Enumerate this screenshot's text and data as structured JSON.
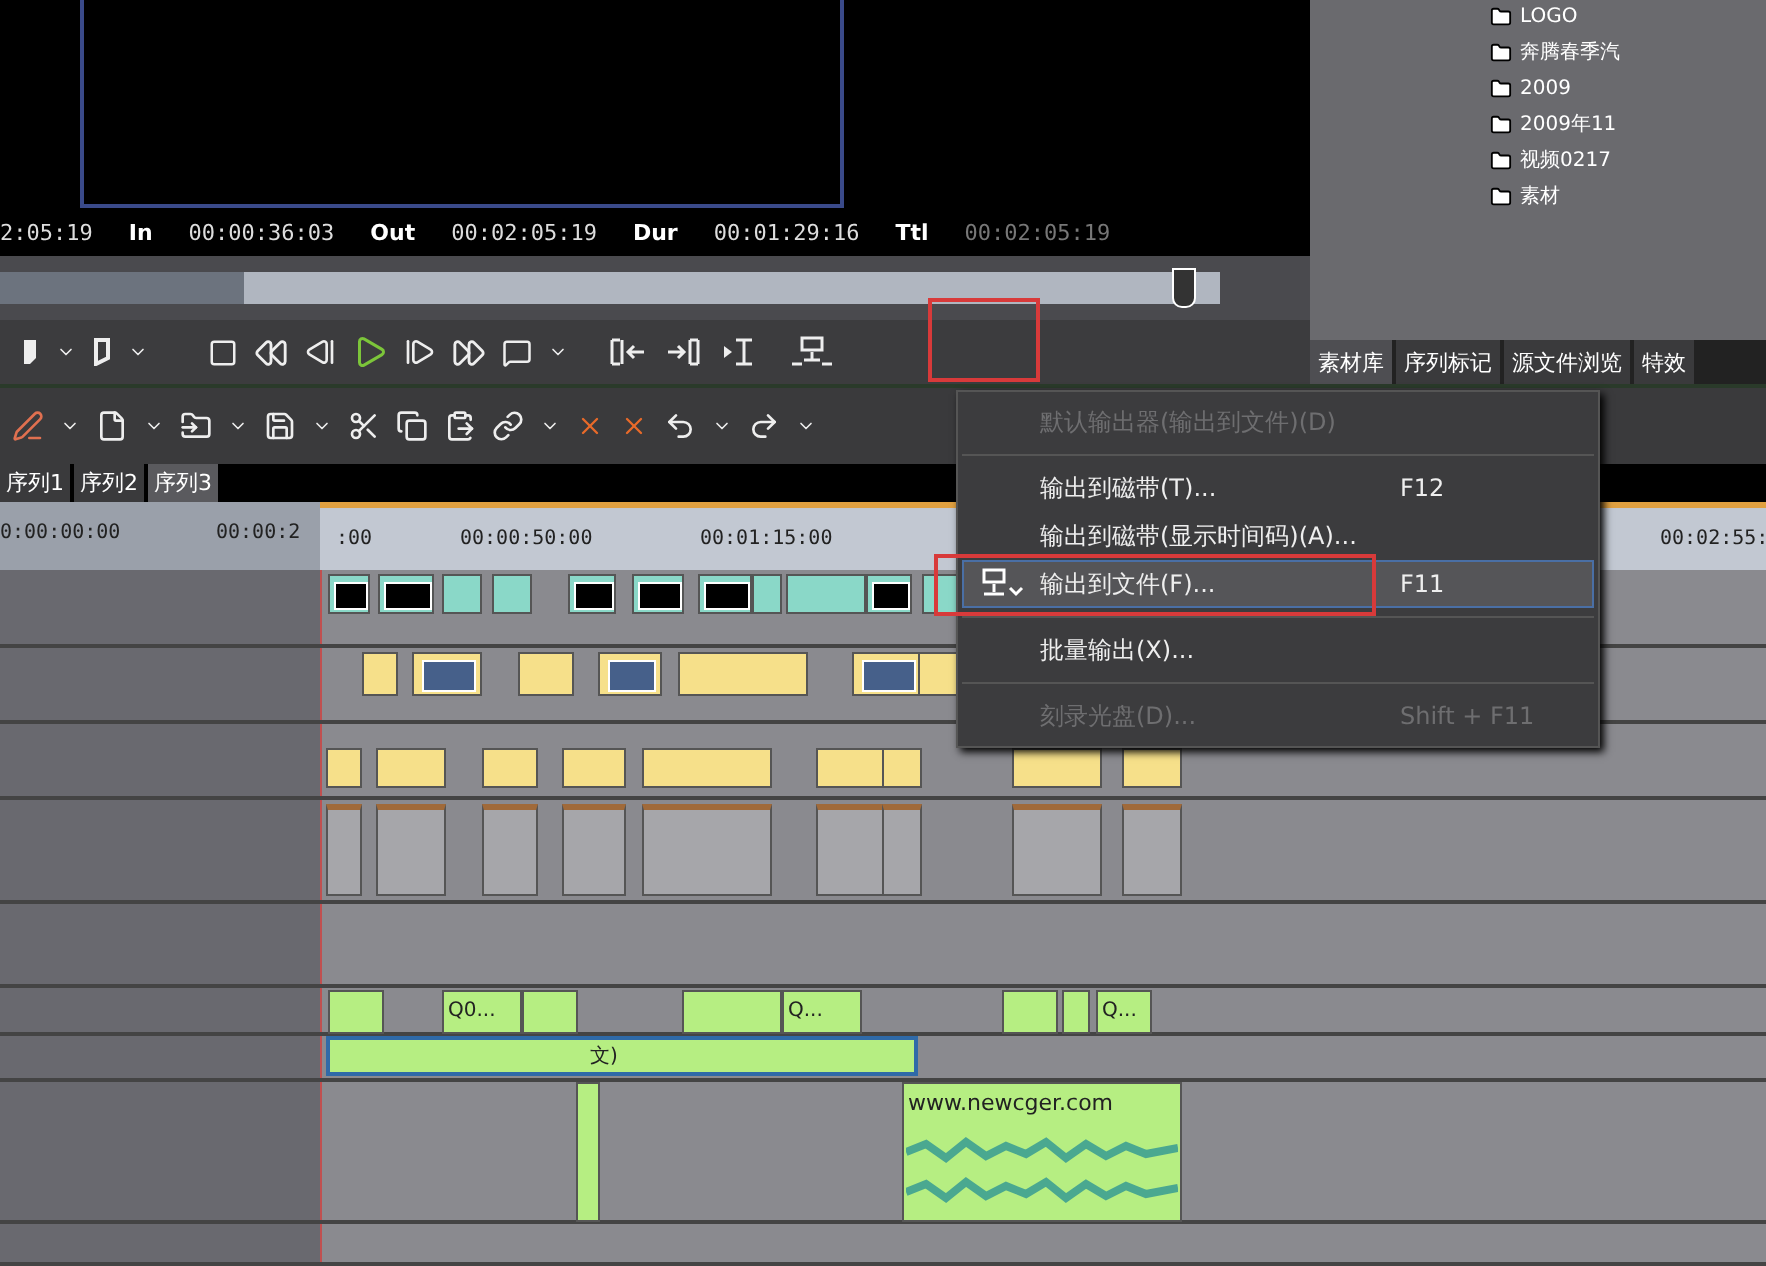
{
  "preview": {
    "timecodes": [
      {
        "value": "2:05:19",
        "dim": false
      },
      {
        "label": "In",
        "value": "00:00:36:03",
        "dim": false
      },
      {
        "label": "Out",
        "value": "00:02:05:19",
        "dim": false
      },
      {
        "label": "Dur",
        "value": "00:01:29:16",
        "dim": false
      },
      {
        "label": "Ttl",
        "value": "00:02:05:19",
        "dim": true
      }
    ],
    "scrub": {
      "level": 0.98
    }
  },
  "bin": {
    "items": [
      {
        "label": "LOGO"
      },
      {
        "label": "奔腾春季汽"
      },
      {
        "label": "2009"
      },
      {
        "label": "2009年11"
      },
      {
        "label": "视频0217"
      },
      {
        "label": "素材"
      }
    ],
    "tabs": [
      {
        "label": "素材库",
        "selected": true
      },
      {
        "label": "序列标记",
        "selected": false
      },
      {
        "label": "源文件浏览",
        "selected": false
      },
      {
        "label": "特效",
        "selected": false
      }
    ]
  },
  "sequence_tabs": [
    {
      "label": "序列1",
      "selected": false
    },
    {
      "label": "序列2",
      "selected": false
    },
    {
      "label": "序列3",
      "selected": true
    }
  ],
  "ruler": {
    "labels": [
      "0:00:00:00",
      "00:00:2",
      ":00",
      "00:00:50:00",
      "00:01:15:00",
      "00:02:55:"
    ]
  },
  "title_clips": [
    "Q0...",
    "Q...",
    "Q...",
    "文)"
  ],
  "audio_clip": {
    "label": "www.newcger.com"
  },
  "menu": {
    "items": [
      {
        "kind": "item",
        "label": "默认输出器(输出到文件)(D)",
        "disabled": true,
        "selected": false,
        "icon": false
      },
      {
        "kind": "separator"
      },
      {
        "kind": "item",
        "label": "输出到磁带(T)...",
        "shortcut": "F12",
        "disabled": false,
        "selected": false,
        "icon": false
      },
      {
        "kind": "item",
        "label": "输出到磁带(显示时间码)(A)...",
        "disabled": false,
        "selected": false,
        "icon": false
      },
      {
        "kind": "item",
        "label": "输出到文件(F)...",
        "shortcut": "F11",
        "disabled": false,
        "selected": true,
        "icon": true
      },
      {
        "kind": "separator"
      },
      {
        "kind": "item",
        "label": "批量输出(X)...",
        "disabled": false,
        "selected": false,
        "icon": false
      },
      {
        "kind": "separator"
      },
      {
        "kind": "item",
        "label": "刻录光盘(D)...",
        "shortcut": "Shift + F11",
        "disabled": true,
        "selected": false,
        "icon": false
      }
    ]
  }
}
